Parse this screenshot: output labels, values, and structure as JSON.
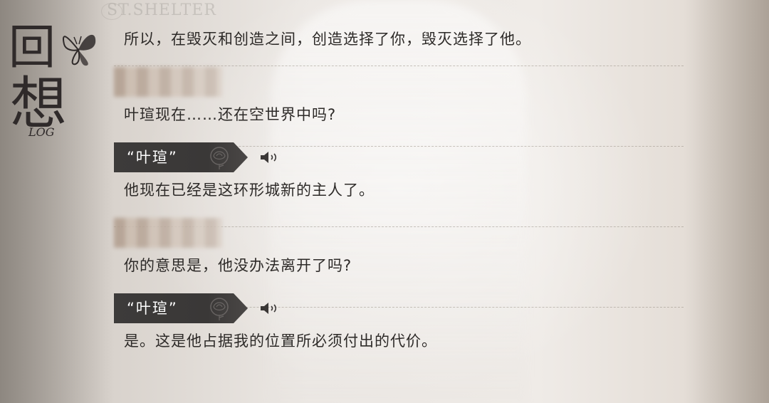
{
  "watermark": "ST.SHELTER",
  "log_title": {
    "char1": "回",
    "char2": "想",
    "en": "LOG"
  },
  "entries": [
    {
      "speaker": null,
      "text": "所以，在毁灭和创造之间，创造选择了你，毁灭选择了他。"
    },
    {
      "speaker": "blurred",
      "text": "叶瑄现在……还在空世界中吗?"
    },
    {
      "speaker": "“叶瑄”",
      "text": "他现在已经是这环形城新的主人了。",
      "voice": "speaker-icon"
    },
    {
      "speaker": "blurred",
      "text": "你的意思是，他没办法离开了吗?"
    },
    {
      "speaker": "“叶瑄”",
      "text": "是。这是他占据我的位置所必须付出的代价。",
      "voice": "speaker-icon"
    }
  ],
  "colors": {
    "tag_bg": "#3d3b3a",
    "text": "#2d2a28",
    "divider": "#8c8278"
  }
}
